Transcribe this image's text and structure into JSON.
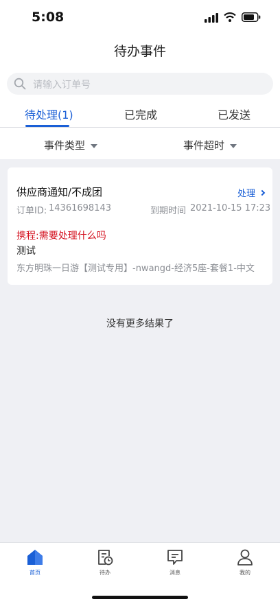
{
  "status_bar": {
    "time": "5:08"
  },
  "header": {
    "title": "待办事件"
  },
  "search": {
    "placeholder": "请输入订单号"
  },
  "tabs": [
    {
      "label": "待处理(1)",
      "active": true
    },
    {
      "label": "已完成",
      "active": false
    },
    {
      "label": "已发送",
      "active": false
    }
  ],
  "filters": [
    {
      "label": "事件类型"
    },
    {
      "label": "事件超时"
    }
  ],
  "event_card": {
    "title": "供应商通知/不成团",
    "action_label": "处理",
    "order_label": "订单ID:",
    "order_id": "14361698143",
    "due_label": "到期时间",
    "due_value": "2021-10-15 17:23",
    "message_red": "携程:需要处理什么吗",
    "message_body": "测试",
    "product": "东方明珠一日游【测试专用】-nwangd-经济5座-套餐1-中文"
  },
  "list_footer": {
    "text": "没有更多结果了"
  },
  "tabbar": {
    "items": [
      {
        "label": "首页",
        "icon": "home-icon",
        "active": true
      },
      {
        "label": "待办",
        "icon": "todo-clock-icon",
        "active": false
      },
      {
        "label": "消息",
        "icon": "message-icon",
        "active": false
      },
      {
        "label": "我的",
        "icon": "profile-icon",
        "active": false
      }
    ]
  },
  "colors": {
    "accent": "#1a5fd6",
    "alert": "#d4101e",
    "background": "#eff0f4"
  }
}
